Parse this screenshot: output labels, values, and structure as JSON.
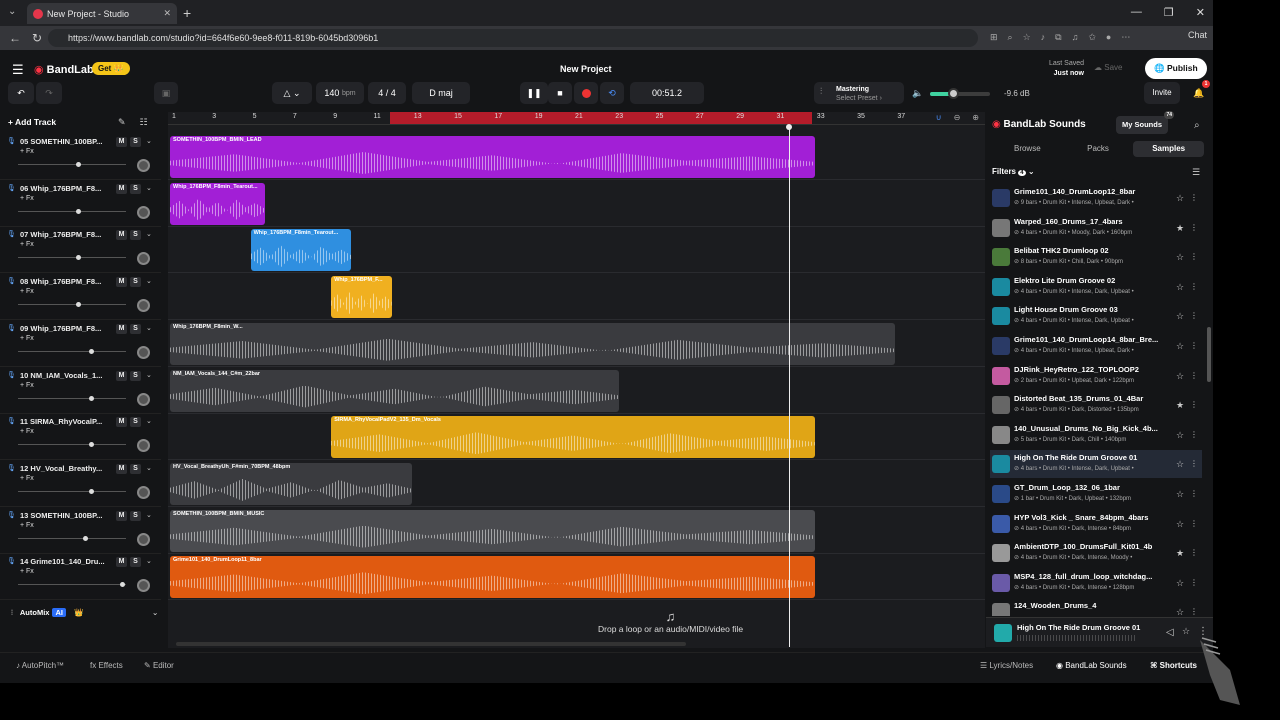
{
  "browser": {
    "tab_title": "New Project - Studio",
    "url": "https://www.bandlab.com/studio?id=664f6e60-9ee8-f011-819b-6045bd3096b1",
    "chat_label": "Chat"
  },
  "header": {
    "logo_text": "BandLab",
    "get_label": "Get 👑",
    "project_title": "New Project",
    "last_saved_label": "Last Saved",
    "last_saved_value": "Just now",
    "save_label": "Save",
    "publish_label": "Publish"
  },
  "transport": {
    "bpm": "140",
    "bpm_unit": "bpm",
    "time_signature": "4 / 4",
    "key": "D maj",
    "time": "00:51.2",
    "mastering_label": "Mastering",
    "mastering_preset": "Select Preset ›",
    "volume_fraction": 0.38,
    "db_value": "-9.6 dB",
    "invite_label": "Invite",
    "notif_count": "1"
  },
  "tracklist": {
    "add_track_label": "Add Track",
    "fx_label": "+ Fx",
    "mute_label": "M",
    "solo_label": "S",
    "tracks": [
      {
        "name": "05 SOMETHIN_100BP...",
        "vol": 0.56
      },
      {
        "name": "06 Whip_176BPM_F8...",
        "vol": 0.56
      },
      {
        "name": "07 Whip_176BPM_F8...",
        "vol": 0.56
      },
      {
        "name": "08 Whip_176BPM_F8...",
        "vol": 0.56
      },
      {
        "name": "09 Whip_176BPM_F8...",
        "vol": 0.68
      },
      {
        "name": "10 NM_IAM_Vocals_1...",
        "vol": 0.68
      },
      {
        "name": "11 SIRMA_RhyVocalP...",
        "vol": 0.68
      },
      {
        "name": "12 HV_Vocal_Breathy...",
        "vol": 0.68
      },
      {
        "name": "13 SOMETHIN_100BP...",
        "vol": 0.62
      },
      {
        "name": "14 Grime101_140_Dru...",
        "vol": 0.96
      }
    ],
    "automix_label": "AutoMix",
    "ai_badge": "AI"
  },
  "ruler": {
    "labels": [
      "1",
      "3",
      "5",
      "7",
      "9",
      "11",
      "13",
      "15",
      "17",
      "19",
      "21",
      "23",
      "25",
      "27",
      "29",
      "31",
      "33",
      "35",
      "37"
    ]
  },
  "clips": [
    {
      "lane": 0,
      "name": "SOMETHIN_100BPM_BMIN_LEAD",
      "start": 1,
      "end": 33,
      "color": "#a21fd6"
    },
    {
      "lane": 1,
      "name": "Whip_176BPM_F8min_Tearout...",
      "start": 1,
      "end": 5.7,
      "color": "#a21fd6"
    },
    {
      "lane": 2,
      "name": "Whip_176BPM_F8min_Tearout...",
      "start": 5,
      "end": 10,
      "color": "#2f8fe0"
    },
    {
      "lane": 3,
      "name": "Whip_176BPM_F...",
      "start": 9,
      "end": 12,
      "color": "#f0b020"
    },
    {
      "lane": 4,
      "name": "Whip_176BPM_F8min_W...",
      "start": 1,
      "end": 37,
      "color": "#3a3b3f"
    },
    {
      "lane": 5,
      "name": "NM_IAM_Vocals_144_C#m_22bar",
      "start": 1,
      "end": 23.3,
      "color": "#3a3b3f"
    },
    {
      "lane": 6,
      "name": "SIRMA_RhyVocalPadV2_135_Dm_Vocals",
      "start": 9,
      "end": 33,
      "color": "#e0a516"
    },
    {
      "lane": 7,
      "name": "HV_Vocal_BreathyUh_F#min_70BPM_48bpm",
      "start": 1,
      "end": 13,
      "color": "#3a3b3f"
    },
    {
      "lane": 8,
      "name": "SOMETHIN_100BPM_BMIN_MUSIC",
      "start": 1,
      "end": 33,
      "color": "#4a4b4f"
    },
    {
      "lane": 9,
      "name": "Grime101_140_DrumLoop11_8bar",
      "start": 1,
      "end": 33,
      "color": "#e05a10"
    }
  ],
  "arrangement": {
    "drop_text": "Drop a loop or an audio/MIDI/video file",
    "playhead_bar": 31
  },
  "sounds_panel": {
    "title": "BandLab Sounds",
    "my_sounds_label": "My Sounds",
    "my_sounds_count": "74",
    "tabs": [
      "Browse",
      "Packs",
      "Samples"
    ],
    "filters_label": "Filters",
    "filters_count": "4",
    "items": [
      {
        "name": "Grime101_140_DrumLoop12_8bar",
        "meta": "⊘ 9 bars • Drum Kit • Intense, Upbeat, Dark •",
        "starred": false,
        "color": "#2a3a66"
      },
      {
        "name": "Warped_160_Drums_17_4bars",
        "meta": "⊘ 4 bars • Drum Kit • Moody, Dark • 160bpm",
        "starred": true,
        "color": "#777"
      },
      {
        "name": "Belibat THK2 Drumloop 02",
        "meta": "⊘ 8 bars • Drum Kit • Chill, Dark • 90bpm",
        "starred": false,
        "color": "#4a7a3a"
      },
      {
        "name": "Elektro Lite Drum Groove 02",
        "meta": "⊘ 4 bars • Drum Kit • Intense, Dark, Upbeat •",
        "starred": false,
        "color": "#1a8aa0"
      },
      {
        "name": "Light House Drum Groove 03",
        "meta": "⊘ 4 bars • Drum Kit • Intense, Dark, Upbeat •",
        "starred": false,
        "color": "#1a8aa0"
      },
      {
        "name": "Grime101_140_DrumLoop14_8bar_Bre...",
        "meta": "⊘ 4 bars • Drum Kit • Intense, Upbeat, Dark •",
        "starred": false,
        "color": "#2a3a66"
      },
      {
        "name": "DJRink_HeyRetro_122_TOPLOOP2",
        "meta": "⊘ 2 bars • Drum Kit • Upbeat, Dark • 122bpm",
        "starred": false,
        "color": "#c45aa0"
      },
      {
        "name": "Distorted Beat_135_Drums_01_4Bar",
        "meta": "⊘ 4 bars • Drum Kit • Dark, Distorted • 135bpm",
        "starred": true,
        "color": "#666"
      },
      {
        "name": "140_Unusual_Drums_No_Big_Kick_4b...",
        "meta": "⊘ 5 bars • Drum Kit • Dark, Chill • 140bpm",
        "starred": false,
        "color": "#888"
      },
      {
        "name": "High On The Ride Drum Groove 01",
        "meta": "⊘ 4 bars • Drum Kit • Intense, Dark, Upbeat •",
        "starred": false,
        "color": "#1a8aa0",
        "highlight": true
      },
      {
        "name": "GT_Drum_Loop_132_06_1bar",
        "meta": "⊘ 1 bar • Drum Kit • Dark, Upbeat • 132bpm",
        "starred": false,
        "color": "#2a4a88"
      },
      {
        "name": "HYP Vol3_Kick _ Snare_84bpm_4bars",
        "meta": "⊘ 4 bars • Drum Kit • Dark, Intense • 84bpm",
        "starred": false,
        "color": "#3a5aa8"
      },
      {
        "name": "AmbientDTP_100_DrumsFull_Kit01_4b",
        "meta": "⊘ 4 bars • Drum Kit • Dark, Intense, Moody •",
        "starred": true,
        "color": "#999"
      },
      {
        "name": "MSP4_128_full_drum_loop_witchdag...",
        "meta": "⊘ 4 bars • Drum Kit • Dark, Intense • 128bpm",
        "starred": false,
        "color": "#6a5aa8"
      },
      {
        "name": "124_Wooden_Drums_4",
        "meta": "",
        "starred": false,
        "color": "#777"
      }
    ],
    "now_playing": "High On The Ride Drum Groove 01"
  },
  "bottombar": {
    "autopitch_label": "AutoPitch™",
    "effects_label": "Effects",
    "editor_label": "Editor",
    "lyrics_label": "Lyrics/Notes",
    "sounds_label": "BandLab Sounds",
    "shortcuts_label": "Shortcuts"
  }
}
